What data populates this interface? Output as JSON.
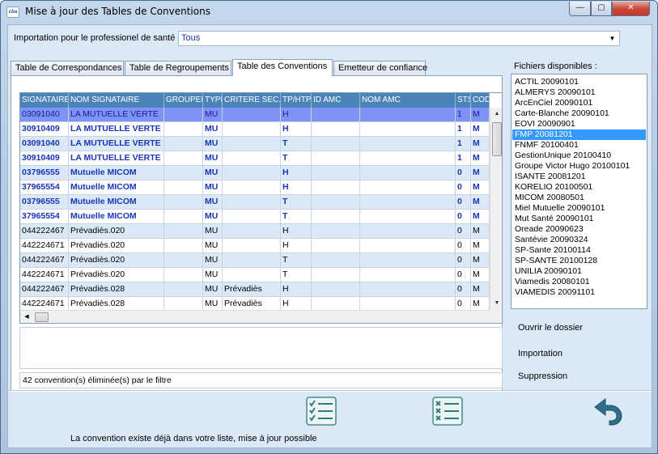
{
  "window": {
    "title": "Mise à jour des Tables de Conventions",
    "app_icon": "cba",
    "minimize": "—",
    "maximize": "▢",
    "close": "✕"
  },
  "import": {
    "label": "Importation pour le professionel de santé",
    "value": "Tous",
    "arrow": "▼"
  },
  "tabs": [
    {
      "label": "Table de Correspondances",
      "active": false
    },
    {
      "label": "Table de Regroupements",
      "active": false
    },
    {
      "label": "Table des Conventions",
      "active": true
    },
    {
      "label": "Emetteur de confiance",
      "active": false
    }
  ],
  "grid": {
    "columns": [
      "SIGNATAIRE",
      "NOM SIGNATAIRE",
      "GROUPEMENT",
      "TYPE",
      "CRITERE SEC.",
      "TP/HTP",
      "ID AMC",
      "NOM AMC",
      "STS",
      "CODE"
    ],
    "rows": [
      {
        "style": "sel",
        "cells": [
          "03091040",
          "LA MUTUELLE VERTE",
          "",
          "MU",
          "",
          "H",
          "",
          "",
          "1",
          "M"
        ]
      },
      {
        "style": "bold",
        "cells": [
          "30910409",
          "LA MUTUELLE VERTE",
          "",
          "MU",
          "",
          "H",
          "",
          "",
          "1",
          "M"
        ]
      },
      {
        "style": "bold alt",
        "cells": [
          "03091040",
          "LA MUTUELLE VERTE",
          "",
          "MU",
          "",
          "T",
          "",
          "",
          "1",
          "M"
        ]
      },
      {
        "style": "bold",
        "cells": [
          "30910409",
          "LA MUTUELLE VERTE",
          "",
          "MU",
          "",
          "T",
          "",
          "",
          "1",
          "M"
        ]
      },
      {
        "style": "bold alt",
        "cells": [
          "03796555",
          "Mutuelle MICOM",
          "",
          "MU",
          "",
          "H",
          "",
          "",
          "0",
          "M"
        ]
      },
      {
        "style": "bold",
        "cells": [
          "37965554",
          "Mutuelle MICOM",
          "",
          "MU",
          "",
          "H",
          "",
          "",
          "0",
          "M"
        ]
      },
      {
        "style": "bold alt",
        "cells": [
          "03796555",
          "Mutuelle MICOM",
          "",
          "MU",
          "",
          "T",
          "",
          "",
          "0",
          "M"
        ]
      },
      {
        "style": "bold",
        "cells": [
          "37965554",
          "Mutuelle MICOM",
          "",
          "MU",
          "",
          "T",
          "",
          "",
          "0",
          "M"
        ]
      },
      {
        "style": "norm alt",
        "cells": [
          "044222467",
          "Prévadiès.020",
          "",
          "MU",
          "",
          "H",
          "",
          "",
          "0",
          "M"
        ]
      },
      {
        "style": "norm",
        "cells": [
          "442224671",
          "Prévadiès.020",
          "",
          "MU",
          "",
          "H",
          "",
          "",
          "0",
          "M"
        ]
      },
      {
        "style": "norm alt",
        "cells": [
          "044222467",
          "Prévadiès.020",
          "",
          "MU",
          "",
          "T",
          "",
          "",
          "0",
          "M"
        ]
      },
      {
        "style": "norm",
        "cells": [
          "442224671",
          "Prévadiès.020",
          "",
          "MU",
          "",
          "T",
          "",
          "",
          "0",
          "M"
        ]
      },
      {
        "style": "norm alt",
        "cells": [
          "044222467",
          "Prévadiès.028",
          "",
          "MU",
          "Prévadiès",
          "H",
          "",
          "",
          "0",
          "M"
        ]
      },
      {
        "style": "norm",
        "cells": [
          "442224671",
          "Prévadiès.028",
          "",
          "MU",
          "Prévadiès",
          "H",
          "",
          "",
          "0",
          "M"
        ]
      }
    ],
    "scroll_up": "▲",
    "scroll_down": "▼",
    "scroll_left": "◀"
  },
  "filter_status": "42 convention(s) éliminée(s) par le filtre",
  "files": {
    "label": "Fichiers disponibles :",
    "items": [
      {
        "label": "ACTIL  20090101",
        "selected": false
      },
      {
        "label": "ALMERYS  20090101",
        "selected": false
      },
      {
        "label": "ArcEnCiel  20090101",
        "selected": false
      },
      {
        "label": "Carte-Blanche  20090101",
        "selected": false
      },
      {
        "label": "EOVI  20090901",
        "selected": false
      },
      {
        "label": "FMP  20081201",
        "selected": true
      },
      {
        "label": "FNMF  20100401",
        "selected": false
      },
      {
        "label": "GestionUnique  20100410",
        "selected": false
      },
      {
        "label": "Groupe Victor Hugo  20100101",
        "selected": false
      },
      {
        "label": "ISANTE  20081201",
        "selected": false
      },
      {
        "label": "KORELIO  20100501",
        "selected": false
      },
      {
        "label": "MICOM  20080501",
        "selected": false
      },
      {
        "label": "Miel Mutuelle  20090101",
        "selected": false
      },
      {
        "label": "Mut Santé  20090101",
        "selected": false
      },
      {
        "label": "Oreade  20090623",
        "selected": false
      },
      {
        "label": "Santévie  20090324",
        "selected": false
      },
      {
        "label": "SP-Sante  20100114",
        "selected": false
      },
      {
        "label": "SP-SANTE  20100128",
        "selected": false
      },
      {
        "label": "UNILIA  20090101",
        "selected": false
      },
      {
        "label": "Viamedis  20080101",
        "selected": false
      },
      {
        "label": "VIAMEDIS  20091101",
        "selected": false
      }
    ]
  },
  "actions": {
    "open_folder": "Ouvrir le dossier",
    "import": "Importation",
    "delete": "Suppression"
  },
  "toolbar": {
    "check_list_icon": "check-list-icon",
    "cross_list_icon": "cross-list-icon",
    "return_icon": "return-arrow-icon"
  },
  "colors": {
    "header_bg": "#4c83b8",
    "selected_row": "#7f93f6",
    "bold_text": "#1a34b8",
    "list_selection": "#3399ff"
  },
  "status_message": "La convention existe déjà dans votre liste, mise à jour possible"
}
